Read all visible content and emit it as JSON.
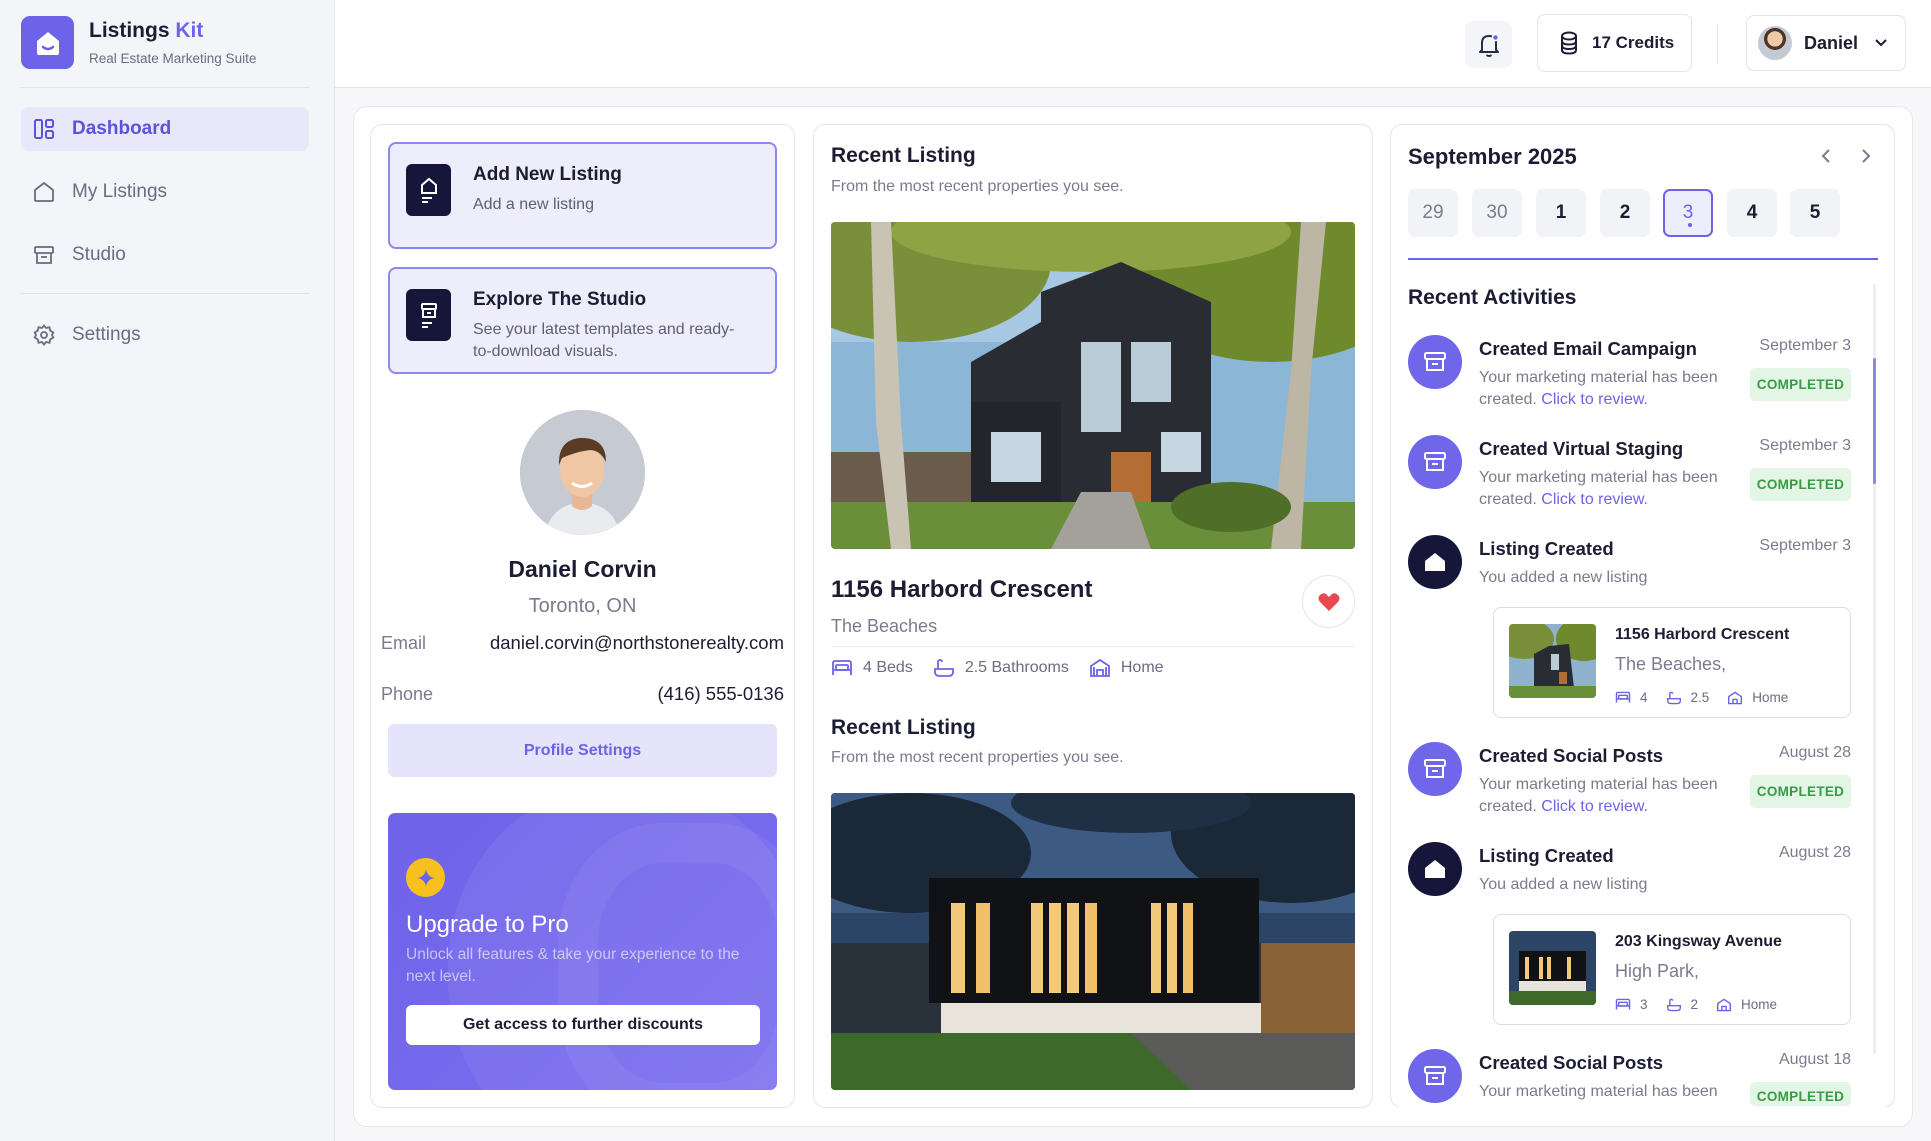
{
  "brand": {
    "name": "Listings",
    "name_accent": "Kit",
    "subtitle": "Real Estate Marketing Suite"
  },
  "sidebar": {
    "items": [
      {
        "label": "Dashboard",
        "icon": "dashboard-icon",
        "active": true
      },
      {
        "label": "My Listings",
        "icon": "home-icon"
      },
      {
        "label": "Studio",
        "icon": "archive-icon"
      },
      {
        "label": "Settings",
        "icon": "gear-icon"
      }
    ]
  },
  "header": {
    "credits_label": "17 Credits",
    "user_name": "Daniel"
  },
  "actions": [
    {
      "title": "Add New Listing",
      "subtitle": "Add a new listing"
    },
    {
      "title": "Explore The Studio",
      "subtitle": "See your latest templates and ready-to-download visuals."
    }
  ],
  "profile": {
    "name": "Daniel Corvin",
    "city": "Toronto, ON",
    "email_label": "Email",
    "email": "daniel.corvin@northstonerealty.com",
    "phone_label": "Phone",
    "phone": "(416) 555-0136",
    "settings_button": "Profile Settings"
  },
  "upgrade": {
    "title": "Upgrade to Pro",
    "subtitle": "Unlock all features & take your experience to the next level.",
    "button": "Get access to further discounts"
  },
  "recent": [
    {
      "title": "Recent Listing",
      "subtitle": "From the most recent properties you see.",
      "name": "1156 Harbord Crescent",
      "area": "The Beaches",
      "beds": "4 Beds",
      "baths": "2.5 Bathrooms",
      "type": "Home"
    },
    {
      "title": "Recent Listing",
      "subtitle": "From the most recent properties you see."
    }
  ],
  "calendar": {
    "month": "September 2025",
    "days": [
      "29",
      "30",
      "1",
      "2",
      "3",
      "4",
      "5"
    ],
    "selected_day": "3"
  },
  "activities": {
    "title": "Recent Activities",
    "items": [
      {
        "title": "Created Email Campaign",
        "date": "September 3",
        "desc": "Your marketing material has been created.",
        "link": "Click to review.",
        "status": "COMPLETED"
      },
      {
        "title": "Created Virtual Staging",
        "date": "September 3",
        "desc": "Your marketing material has been created.",
        "link": "Click to review.",
        "status": "COMPLETED"
      },
      {
        "title": "Listing Created",
        "date": "September 3",
        "desc": "You added a new listing",
        "listing": {
          "name": "1156 Harbord Crescent",
          "area": "The Beaches,",
          "beds": "4",
          "baths": "2.5",
          "type": "Home"
        }
      },
      {
        "title": "Created Social Posts",
        "date": "August 28",
        "desc": "Your marketing material has been created.",
        "link": "Click to review.",
        "status": "COMPLETED"
      },
      {
        "title": "Listing Created",
        "date": "August 28",
        "desc": "You added a new listing",
        "listing": {
          "name": "203 Kingsway Avenue",
          "area": "High Park,",
          "beds": "3",
          "baths": "2",
          "type": "Home"
        }
      },
      {
        "title": "Created Social Posts",
        "date": "August 18",
        "desc": "Your marketing material has been",
        "status": "COMPLETED"
      }
    ]
  },
  "colors": {
    "accent": "#6c63e8",
    "dark": "#15163a",
    "success_bg": "#e3f5e4",
    "success_text": "#3a9a46",
    "heart": "#e8484f"
  }
}
